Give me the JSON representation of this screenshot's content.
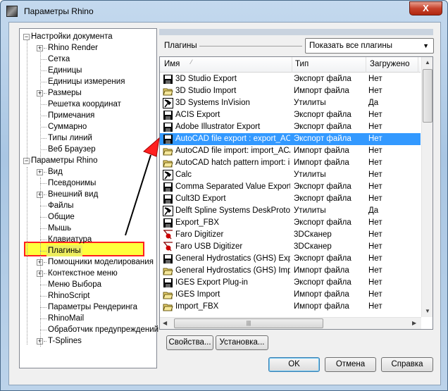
{
  "window": {
    "title": "Параметры Rhino",
    "close_label": "X"
  },
  "tree": [
    {
      "label": "Настройки документа",
      "level": 0,
      "toggle": "-"
    },
    {
      "label": "Rhino Render",
      "level": 1,
      "toggle": "+"
    },
    {
      "label": "Сетка",
      "level": 1
    },
    {
      "label": "Единицы",
      "level": 1
    },
    {
      "label": "Единицы измерения",
      "level": 1
    },
    {
      "label": "Размеры",
      "level": 1,
      "toggle": "+"
    },
    {
      "label": "Решетка координат",
      "level": 1
    },
    {
      "label": "Примечания",
      "level": 1
    },
    {
      "label": "Суммарно",
      "level": 1
    },
    {
      "label": "Типы линий",
      "level": 1
    },
    {
      "label": "Веб Браузер",
      "level": 1
    },
    {
      "label": "Параметры Rhino",
      "level": 0,
      "toggle": "-"
    },
    {
      "label": "Вид",
      "level": 1,
      "toggle": "+"
    },
    {
      "label": "Псевдонимы",
      "level": 1
    },
    {
      "label": "Внешний вид",
      "level": 1,
      "toggle": "+"
    },
    {
      "label": "Файлы",
      "level": 1
    },
    {
      "label": "Общие",
      "level": 1
    },
    {
      "label": "Мышь",
      "level": 1
    },
    {
      "label": "Клавиатура",
      "level": 1
    },
    {
      "label": "Плагины",
      "level": 1,
      "selected": true
    },
    {
      "label": "Помощники моделирования",
      "level": 1,
      "toggle": "+"
    },
    {
      "label": "Контекстное меню",
      "level": 1,
      "toggle": "+"
    },
    {
      "label": "Меню Выбора",
      "level": 1
    },
    {
      "label": "RhinoScript",
      "level": 1
    },
    {
      "label": "Параметры Рендеринга",
      "level": 1
    },
    {
      "label": "RhinoMail",
      "level": 1
    },
    {
      "label": "Обработчик предупреждений",
      "level": 1
    },
    {
      "label": "T-Splines",
      "level": 1,
      "toggle": "+"
    }
  ],
  "plugins": {
    "label": "Плагины",
    "filter": "Показать все плагины",
    "columns": [
      "Имя",
      "Тип",
      "Загружено"
    ],
    "rows": [
      {
        "name": "3D Studio Export",
        "type": "Экспорт файла",
        "loaded": "Нет",
        "icon": "save"
      },
      {
        "name": "3D Studio Import",
        "type": "Импорт файла",
        "loaded": "Нет",
        "icon": "folder"
      },
      {
        "name": "3D Systems InVision",
        "type": "Утилиты",
        "loaded": "Да",
        "icon": "tool"
      },
      {
        "name": "ACIS Export",
        "type": "Экспорт файла",
        "loaded": "Нет",
        "icon": "save"
      },
      {
        "name": "Adobe Illustrator Export",
        "type": "Экспорт файла",
        "loaded": "Нет",
        "icon": "save"
      },
      {
        "name": "AutoCAD file export : export_AC...",
        "type": "Экспорт файла",
        "loaded": "Нет",
        "icon": "save",
        "selected": true
      },
      {
        "name": "AutoCAD file import: import_ACAD",
        "type": "Импорт файла",
        "loaded": "Нет",
        "icon": "folder"
      },
      {
        "name": "AutoCAD hatch pattern import: i...",
        "type": "Импорт файла",
        "loaded": "Нет",
        "icon": "folder"
      },
      {
        "name": "Calc",
        "type": "Утилиты",
        "loaded": "Нет",
        "icon": "tool"
      },
      {
        "name": "Comma Separated Value Export",
        "type": "Экспорт файла",
        "loaded": "Нет",
        "icon": "save"
      },
      {
        "name": "Cult3D Export",
        "type": "Экспорт файла",
        "loaded": "Нет",
        "icon": "save"
      },
      {
        "name": "Delft Spline Systems DeskProto",
        "type": "Утилиты",
        "loaded": "Да",
        "icon": "tool"
      },
      {
        "name": "Export_FBX",
        "type": "Экспорт файла",
        "loaded": "Нет",
        "icon": "save"
      },
      {
        "name": "Faro Digitizer",
        "type": "3DСканер",
        "loaded": "Нет",
        "icon": "scanner"
      },
      {
        "name": "Faro USB Digitizer",
        "type": "3DСканер",
        "loaded": "Нет",
        "icon": "scanner"
      },
      {
        "name": "General Hydrostatics (GHS) Exp...",
        "type": "Экспорт файла",
        "loaded": "Нет",
        "icon": "save"
      },
      {
        "name": "General Hydrostatics (GHS) Imp...",
        "type": "Импорт файла",
        "loaded": "Нет",
        "icon": "folder"
      },
      {
        "name": "IGES Export Plug-in",
        "type": "Экспорт файла",
        "loaded": "Нет",
        "icon": "save"
      },
      {
        "name": "IGES Import",
        "type": "Импорт файла",
        "loaded": "Нет",
        "icon": "folder"
      },
      {
        "name": "Import_FBX",
        "type": "Импорт файла",
        "loaded": "Нет",
        "icon": "folder"
      }
    ]
  },
  "buttons": {
    "properties": "Свойства...",
    "install": "Установка...",
    "ok": "OK",
    "cancel": "Отмена",
    "help": "Справка"
  },
  "colors": {
    "selection": "#3399ff",
    "highlight": "#ffff3c",
    "annotation": "#ff2020"
  }
}
